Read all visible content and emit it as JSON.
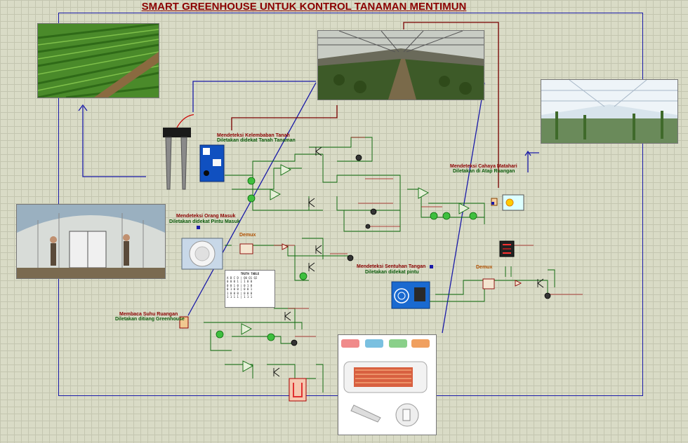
{
  "title": "SMART GREENHOUSE UNTUK KONTROL TANAMAN MENTIMUN",
  "labels": {
    "soil_1": "Mendeteksi Kelembaban Tanah",
    "soil_2": "Diletakan didekat Tanah Tanaman",
    "person_1": "Mendeteksi Orang Masuk",
    "person_2": "Diletakan didekat Pintu Masuk",
    "light_1": "Mendeteksi Cahaya Matahari",
    "light_2": "Diletakan di Atap Ruangan",
    "touch_1": "Mendeteksi Sentuhan Tangan",
    "touch_2": "Diletakan didekat pintu",
    "temp_1": "Membaca Suhu Ruangan",
    "temp_2": "Diletakan ditiang Greenhouse"
  },
  "demux": [
    "Demux",
    "Demux"
  ]
}
